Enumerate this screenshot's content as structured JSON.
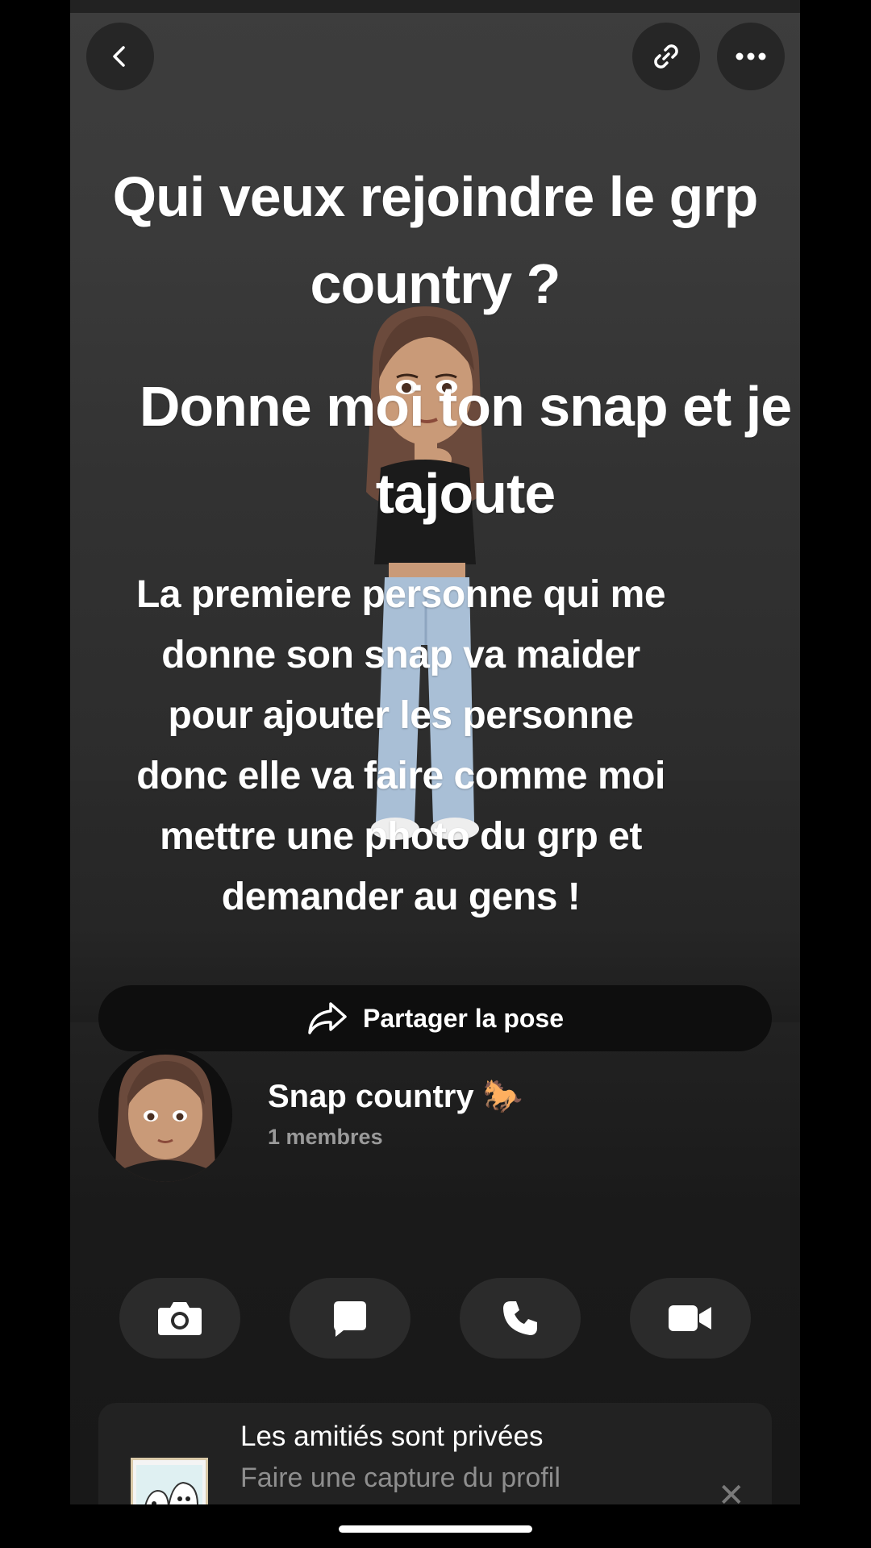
{
  "overlay": {
    "title": "Qui veux rejoindre le grp country ?",
    "subtitle": "Donne moi ton snap et je tajoute",
    "body": "La premiere personne qui me donne son snap va maider pour ajouter les personne donc elle va faire comme moi mettre une photo du grp et demander au gens !"
  },
  "share": {
    "label": "Partager la pose",
    "icon": "share-arrow-icon"
  },
  "group": {
    "name": "Snap country 🐎",
    "members": "1 membres"
  },
  "actions": [
    {
      "name": "camera",
      "icon": "camera-icon"
    },
    {
      "name": "chat",
      "icon": "chat-bubble-icon"
    },
    {
      "name": "call",
      "icon": "phone-icon"
    },
    {
      "name": "video",
      "icon": "video-camera-icon"
    }
  ],
  "privacy_card": {
    "title": "Les amitiés sont privées",
    "subtitle": "Faire une capture du profil",
    "close": "✕"
  },
  "colors": {
    "background": "#000000",
    "panel": "#262626",
    "text": "#ffffff",
    "muted": "#9a9a9a"
  }
}
